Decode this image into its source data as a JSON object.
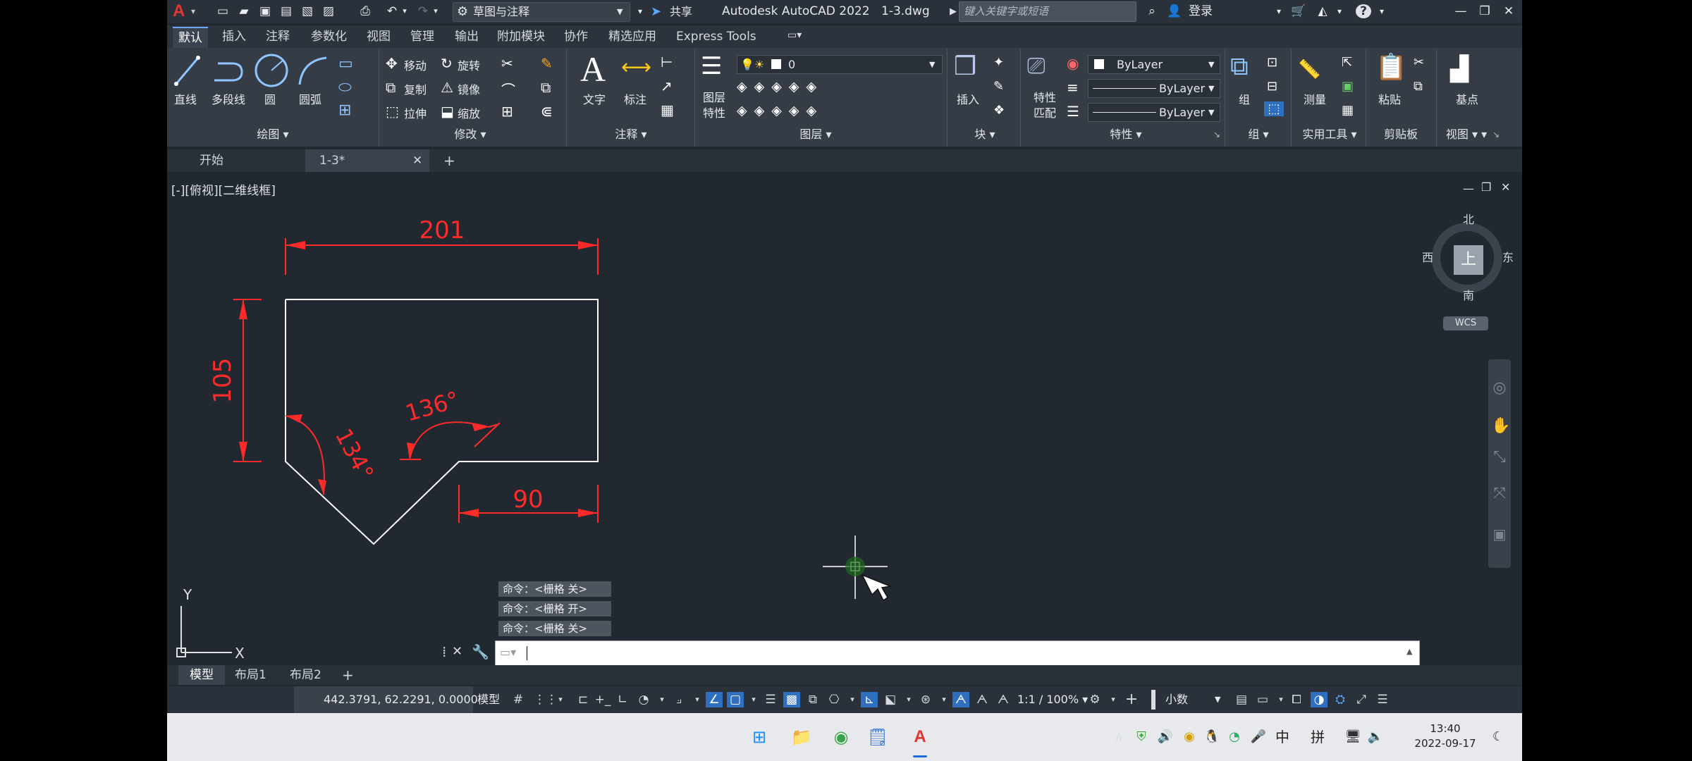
{
  "titlebar": {
    "app_title": "Autodesk AutoCAD 2022",
    "file_name": "1-3.dwg",
    "workspace": "草图与注释",
    "share": "共享",
    "search_placeholder": "键入关键字或短语",
    "login": "登录"
  },
  "ribbon_tabs": [
    "默认",
    "插入",
    "注释",
    "参数化",
    "视图",
    "管理",
    "输出",
    "附加模块",
    "协作",
    "精选应用",
    "Express Tools"
  ],
  "ribbon": {
    "draw": {
      "title": "绘图",
      "line": "直线",
      "polyline": "多段线",
      "circle": "圆",
      "arc": "圆弧"
    },
    "modify": {
      "title": "修改",
      "move": "移动",
      "rotate": "旋转",
      "copy": "复制",
      "mirror": "镜像",
      "stretch": "拉伸",
      "scale": "缩放"
    },
    "annotation": {
      "title": "注释",
      "text": "文字",
      "dimension": "标注"
    },
    "layers": {
      "title": "图层",
      "layer_properties": "图层\n特性",
      "current_layer": "0"
    },
    "block": {
      "title": "块",
      "insert": "插入"
    },
    "properties": {
      "title": "特性",
      "match": "特性\n匹配",
      "color": "ByLayer",
      "linetype": "ByLayer",
      "lineweight": "ByLayer"
    },
    "groups": {
      "title": "组",
      "group": "组"
    },
    "utilities": {
      "title": "实用工具",
      "measure": "测量"
    },
    "clipboard": {
      "title": "剪贴板",
      "paste": "粘贴"
    },
    "view": {
      "title": "视图",
      "base": "基点"
    }
  },
  "doc_tabs": {
    "start": "开始",
    "file": "1-3*"
  },
  "viewport_label": "[-][俯视][二维线框]",
  "drawing": {
    "dim_top": "201",
    "dim_left": "105",
    "dim_bottom": "90",
    "angle_left": "134°",
    "angle_mid": "136°"
  },
  "viewcube": {
    "north": "北",
    "south": "南",
    "east": "东",
    "west": "西",
    "top": "上",
    "wcs": "WCS"
  },
  "ucs": {
    "x": "X",
    "y": "Y"
  },
  "command_history": [
    "命令：<栅格 关>",
    "命令：<栅格 开>",
    "命令：<栅格 关>"
  ],
  "layout_tabs": [
    "模型",
    "布局1",
    "布局2"
  ],
  "statusbar": {
    "coords": "442.3791, 62.2291, 0.0000",
    "model": "模型",
    "scale": "1:1 / 100%",
    "units": "小数"
  },
  "taskbar": {
    "time": "13:40",
    "date": "2022-09-17",
    "ime_lang": "中",
    "ime_mode": "拼"
  }
}
